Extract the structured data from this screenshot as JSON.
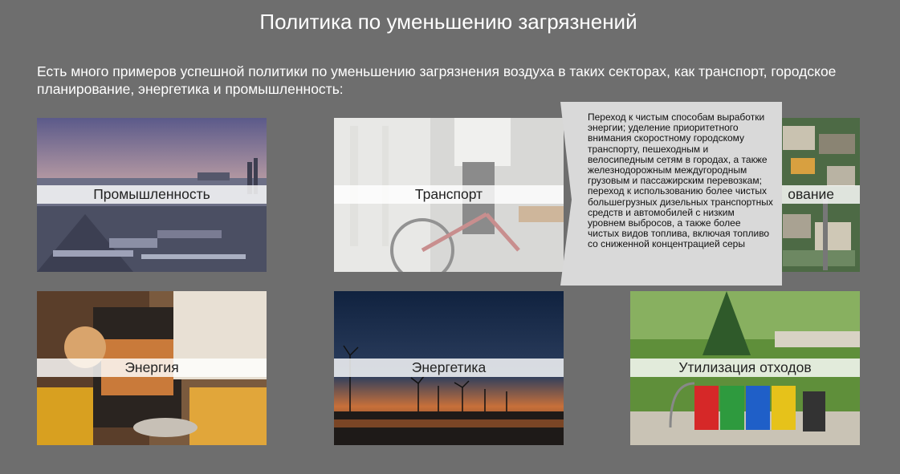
{
  "header": {
    "title": "Политика по уменьшению загрязнений"
  },
  "intro": {
    "text": "Есть много примеров успешной политики по уменьшению загрязнения воздуха в таких секторах, как транспорт, городское планирование, энергетика и промышленность:"
  },
  "cards": [
    {
      "label": "Промышленность",
      "image": "industrial-port-image"
    },
    {
      "label": "Транспорт",
      "image": "bicycle-rider-image"
    },
    {
      "label": "Городское планирование",
      "visible_label": "ование",
      "image": "aerial-city-image"
    },
    {
      "label": "Энергия",
      "image": "kitchen-oven-image"
    },
    {
      "label": "Энергетика",
      "image": "wind-turbines-sunset-image"
    },
    {
      "label": "Утилизация отходов",
      "image": "recycling-bins-image"
    }
  ],
  "tooltip": {
    "text": "Переход к чистым способам выработки энергии; уделение приоритетного внимания скоростному городскому транспорту, пешеходным и велосипедным сетям в городах, а также железнодорожным междугородным грузовым и пассажирским перевозкам; переход к использованию более чистых большегрузных дизельных транспортных средств и автомобилей с низким уровнем выбросов, а также более чистых видов топлива, включая топливо со сниженной концентрацией серы"
  },
  "colors": {
    "background": "#6e6e6e",
    "tooltip_background": "#d9d9d9",
    "label_band": "#ffffff"
  }
}
